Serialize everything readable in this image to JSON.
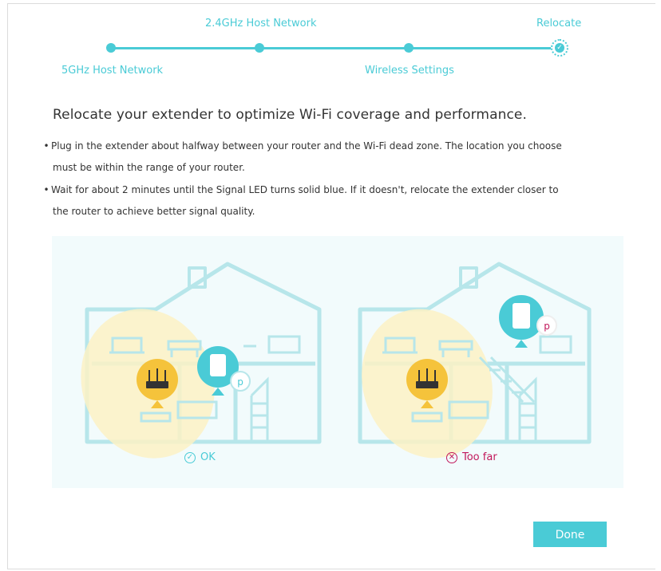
{
  "stepper": {
    "steps": [
      {
        "label": "5GHz Host Network"
      },
      {
        "label": "2.4GHz Host Network"
      },
      {
        "label": "Wireless Settings"
      },
      {
        "label": "Relocate"
      }
    ],
    "current_icon": "check-icon"
  },
  "content": {
    "heading": "Relocate your extender to optimize Wi-Fi coverage and performance.",
    "bullets": [
      {
        "line1": "Plug in the extender about halfway between your router and the Wi-Fi dead zone. The location you choose",
        "line2": "must be within the range of your router."
      },
      {
        "line1": "Wait for about 2 minutes until the Signal LED turns solid blue. If it doesn't, relocate the extender closer to",
        "line2": "the router to achieve better signal quality."
      }
    ]
  },
  "illustration": {
    "ok_label": "OK",
    "ok_icon": "check-circle-icon",
    "bad_label": "Too far",
    "bad_icon": "x-circle-icon"
  },
  "actions": {
    "done_label": "Done"
  },
  "colors": {
    "accent": "#4acbd6",
    "house_line": "#b7e6ea",
    "coverage": "#fdf1c4",
    "router": "#f5c33b",
    "warning": "#c2185b"
  }
}
